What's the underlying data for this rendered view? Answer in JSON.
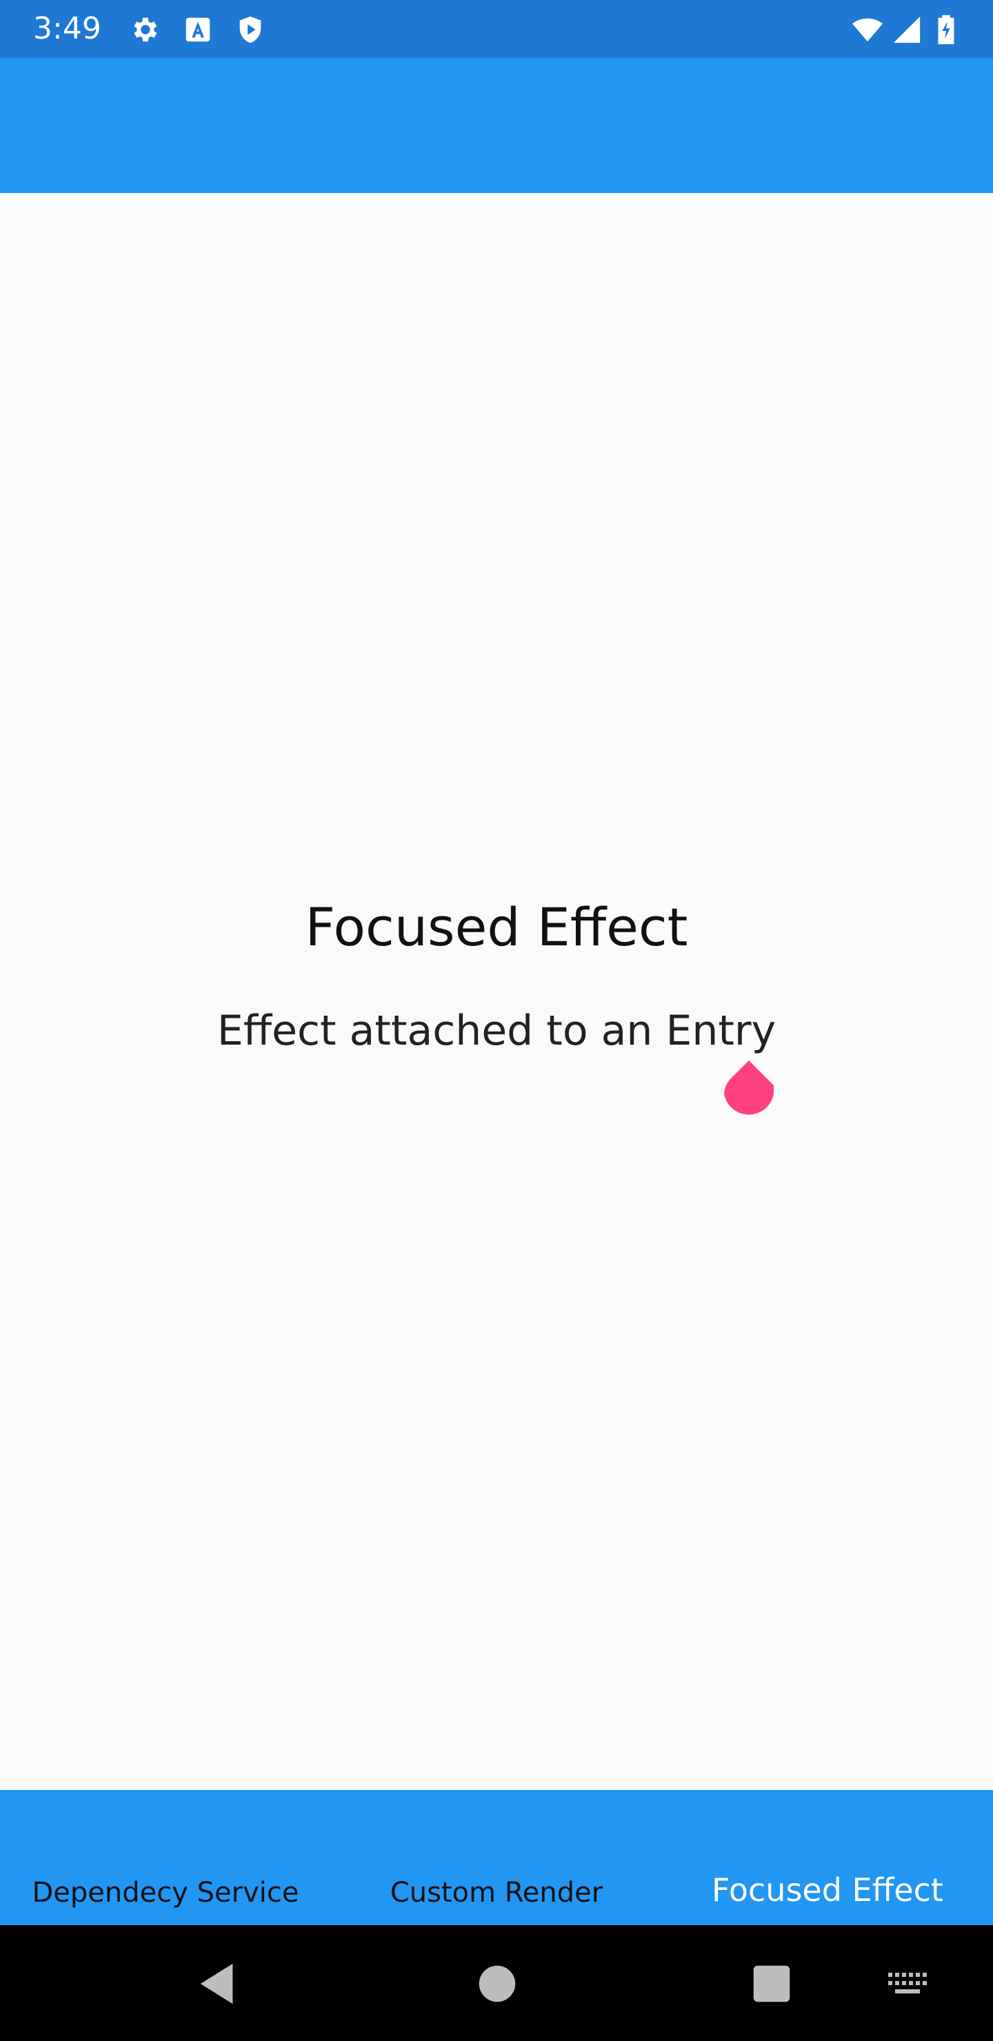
{
  "status_bar": {
    "time": "3:49",
    "icons_left": [
      "gear-icon",
      "a-badge-icon",
      "shield-play-icon"
    ],
    "icons_right": [
      "wifi-icon",
      "cell-signal-icon",
      "battery-charging-icon"
    ]
  },
  "page": {
    "title": "Focused Effect",
    "entry_text": "Effect attached to an Entry"
  },
  "tabs": [
    {
      "label": "Dependecy Service",
      "active": false
    },
    {
      "label": "Custom Render",
      "active": false
    },
    {
      "label": "Focused Effect",
      "active": true
    }
  ],
  "nav_bar": {
    "buttons": [
      "back-icon",
      "home-icon",
      "recents-icon",
      "keyboard-icon"
    ]
  },
  "colors": {
    "status_bar": "#1E78D4",
    "app_bar": "#2196F3",
    "accent": "#FF4081",
    "background": "#FAFAFA"
  }
}
